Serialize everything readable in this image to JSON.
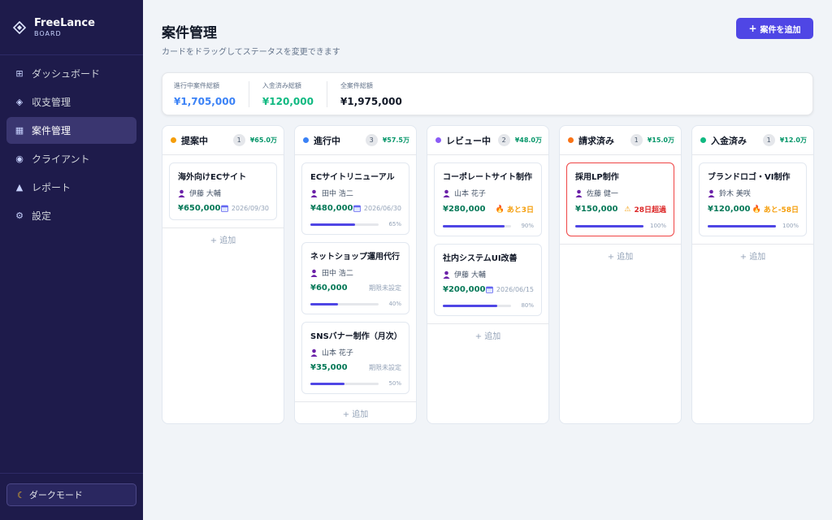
{
  "brand": {
    "name": "FreeLance",
    "sub": "BOARD"
  },
  "nav": [
    {
      "label": "ダッシュボード",
      "icon": "grid-icon",
      "active": false
    },
    {
      "label": "収支管理",
      "icon": "diamond-icon",
      "active": false
    },
    {
      "label": "案件管理",
      "icon": "table-icon",
      "active": true
    },
    {
      "label": "クライアント",
      "icon": "target-icon",
      "active": false
    },
    {
      "label": "レポート",
      "icon": "triangle-icon",
      "active": false
    },
    {
      "label": "設定",
      "icon": "gear-icon",
      "active": false
    }
  ],
  "dark_mode_label": "ダークモード",
  "header": {
    "title": "案件管理",
    "subtitle": "カードをドラッグしてステータスを変更できます",
    "add_button": "案件を追加"
  },
  "summary": [
    {
      "label": "進行中案件総額",
      "value": "¥1,705,000",
      "color": "#3b82f6"
    },
    {
      "label": "入金済み総額",
      "value": "¥120,000",
      "color": "#10b981"
    },
    {
      "label": "全案件総額",
      "value": "¥1,975,000",
      "color": "#111827"
    }
  ],
  "add_label": "+ 追加",
  "columns": [
    {
      "title": "提案中",
      "dot": "#f59e0b",
      "count": "1",
      "total": "¥65.0万",
      "cards": [
        {
          "title": "海外向けECサイト",
          "client": "伊藤 大輔",
          "amount": "¥650,000",
          "meta": "2026/09/30",
          "meta_type": "date"
        }
      ]
    },
    {
      "title": "進行中",
      "dot": "#3b82f6",
      "count": "3",
      "total": "¥57.5万",
      "cards": [
        {
          "title": "ECサイトリニューアル",
          "client": "田中 浩二",
          "amount": "¥480,000",
          "meta": "2026/06/30",
          "meta_type": "date",
          "progress": 65
        },
        {
          "title": "ネットショップ運用代行",
          "client": "田中 浩二",
          "amount": "¥60,000",
          "meta": "期限未設定",
          "meta_type": "plain",
          "progress": 40
        },
        {
          "title": "SNSバナー制作（月次）",
          "client": "山本 花子",
          "amount": "¥35,000",
          "meta": "期限未設定",
          "meta_type": "plain",
          "progress": 50
        }
      ]
    },
    {
      "title": "レビュー中",
      "dot": "#8b5cf6",
      "count": "2",
      "total": "¥48.0万",
      "cards": [
        {
          "title": "コーポレートサイト制作",
          "client": "山本 花子",
          "amount": "¥280,000",
          "meta": "あと3日",
          "meta_type": "warn",
          "progress": 90
        },
        {
          "title": "社内システムUI改善",
          "client": "伊藤 大輔",
          "amount": "¥200,000",
          "meta": "2026/06/15",
          "meta_type": "date",
          "progress": 80
        }
      ]
    },
    {
      "title": "請求済み",
      "dot": "#f97316",
      "count": "1",
      "total": "¥15.0万",
      "cards": [
        {
          "title": "採用LP制作",
          "client": "佐藤 健一",
          "amount": "¥150,000",
          "meta": "28日超過",
          "meta_type": "danger",
          "progress": 100,
          "overdue": true
        }
      ]
    },
    {
      "title": "入金済み",
      "dot": "#10b981",
      "count": "1",
      "total": "¥12.0万",
      "cards": [
        {
          "title": "ブランドロゴ・VI制作",
          "client": "鈴木 美咲",
          "amount": "¥120,000",
          "meta": "あと-58日",
          "meta_type": "warn",
          "progress": 100
        }
      ]
    }
  ]
}
